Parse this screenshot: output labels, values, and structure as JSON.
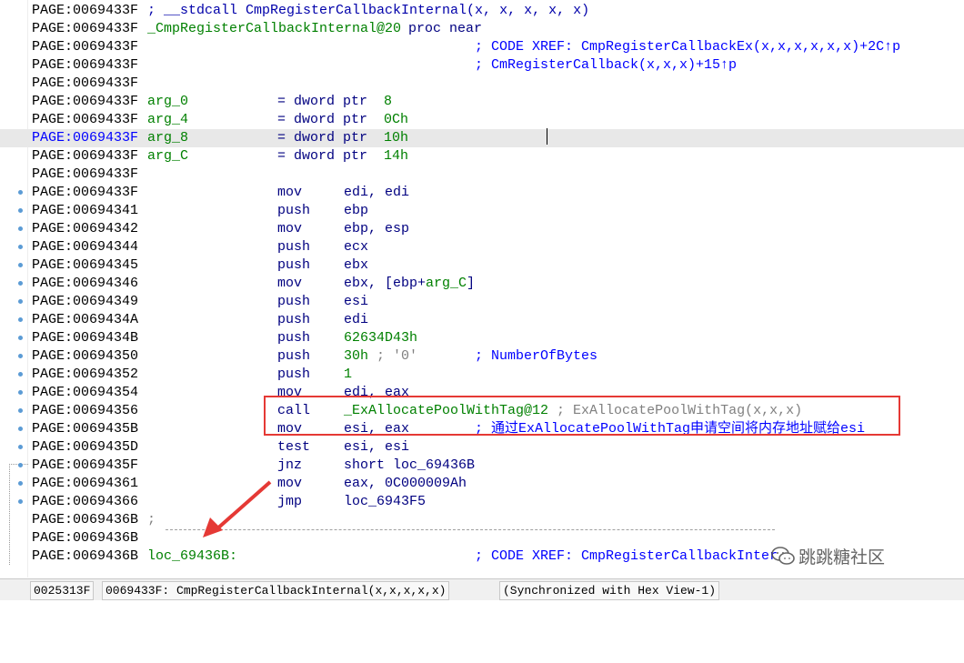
{
  "rows": [
    {
      "addr": "PAGE:0069433F",
      "a": "; __stdcall CmpRegisterCallbackInternal(x, x, x, x, x)"
    },
    {
      "addr": "PAGE:0069433F",
      "a": "_CmpRegisterCallbackInternal@20",
      "b": "proc near"
    },
    {
      "addr": "PAGE:0069433F",
      "c": "; CODE XREF: CmpRegisterCallbackEx(x,x,x,x,x,x)+2C↑p"
    },
    {
      "addr": "PAGE:0069433F",
      "c": "; CmRegisterCallback(x,x,x)+15↑p"
    },
    {
      "addr": "PAGE:0069433F"
    },
    {
      "addr": "PAGE:0069433F",
      "lbl": "arg_0",
      "eq": "= dword ptr",
      "v": "8"
    },
    {
      "addr": "PAGE:0069433F",
      "lbl": "arg_4",
      "eq": "= dword ptr",
      "v": "0Ch"
    },
    {
      "addr": "PAGE:0069433F",
      "lbl": "arg_8",
      "eq": "= dword ptr",
      "v": "10h"
    },
    {
      "addr": "PAGE:0069433F",
      "lbl": "arg_C",
      "eq": "= dword ptr",
      "v": "14h"
    },
    {
      "addr": "PAGE:0069433F"
    },
    {
      "addr": "PAGE:0069433F",
      "m": "mov",
      "o": "edi, edi"
    },
    {
      "addr": "PAGE:00694341",
      "m": "push",
      "o": "ebp"
    },
    {
      "addr": "PAGE:00694342",
      "m": "mov",
      "o": "ebp, esp"
    },
    {
      "addr": "PAGE:00694344",
      "m": "push",
      "o": "ecx"
    },
    {
      "addr": "PAGE:00694345",
      "m": "push",
      "o": "ebx"
    },
    {
      "addr": "PAGE:00694346",
      "m": "mov",
      "o": "ebx, [ebp+",
      "og": "arg_C",
      "oe": "]"
    },
    {
      "addr": "PAGE:00694349",
      "m": "push",
      "o": "esi"
    },
    {
      "addr": "PAGE:0069434A",
      "m": "push",
      "o": "edi"
    },
    {
      "addr": "PAGE:0069434B",
      "m": "push",
      "og": "62634D43h"
    },
    {
      "addr": "PAGE:00694350",
      "m": "push",
      "og": "30h",
      "od": " ; '0'",
      "c": "; NumberOfBytes"
    },
    {
      "addr": "PAGE:00694352",
      "m": "push",
      "og": "1"
    },
    {
      "addr": "PAGE:00694354",
      "m": "mov",
      "o": "edi, eax"
    },
    {
      "addr": "PAGE:00694356",
      "m": "call",
      "og": "_ExAllocatePoolWithTag@12",
      "od": " ; ExAllocatePoolWithTag(x,x,x)"
    },
    {
      "addr": "PAGE:0069435B",
      "m": "mov",
      "o": "esi, eax",
      "c": "; 通过ExAllocatePoolWithTag申请空间将内存地址赋给esi"
    },
    {
      "addr": "PAGE:0069435D",
      "m": "test",
      "o": "esi, esi"
    },
    {
      "addr": "PAGE:0069435F",
      "m": "jnz",
      "o": "short loc_69436B"
    },
    {
      "addr": "PAGE:00694361",
      "m": "mov",
      "o": "eax, 0C000009Ah"
    },
    {
      "addr": "PAGE:00694366",
      "m": "jmp",
      "o": "loc_6943F5"
    },
    {
      "addr": "PAGE:0069436B",
      "d": ";"
    },
    {
      "addr": "PAGE:0069436B"
    },
    {
      "addr": "PAGE:0069436B",
      "lbl": "loc_69436B:",
      "c": "; CODE XREF: CmpRegisterCallbackInter"
    }
  ],
  "dots": [
    10,
    11,
    12,
    13,
    14,
    15,
    16,
    17,
    18,
    19,
    20,
    21,
    22,
    23,
    24,
    25,
    26,
    27
  ],
  "selected_row": 7,
  "status": {
    "offset": "0025313F",
    "location": "0069433F: CmpRegisterCallbackInternal(x,x,x,x,x)",
    "sync": "(Synchronized with Hex View-1)"
  },
  "watermark": "跳跳糖社区",
  "colors": {
    "highlight_box": "#e53935",
    "arrow": "#e53935",
    "selection": "#e8e8e8"
  }
}
